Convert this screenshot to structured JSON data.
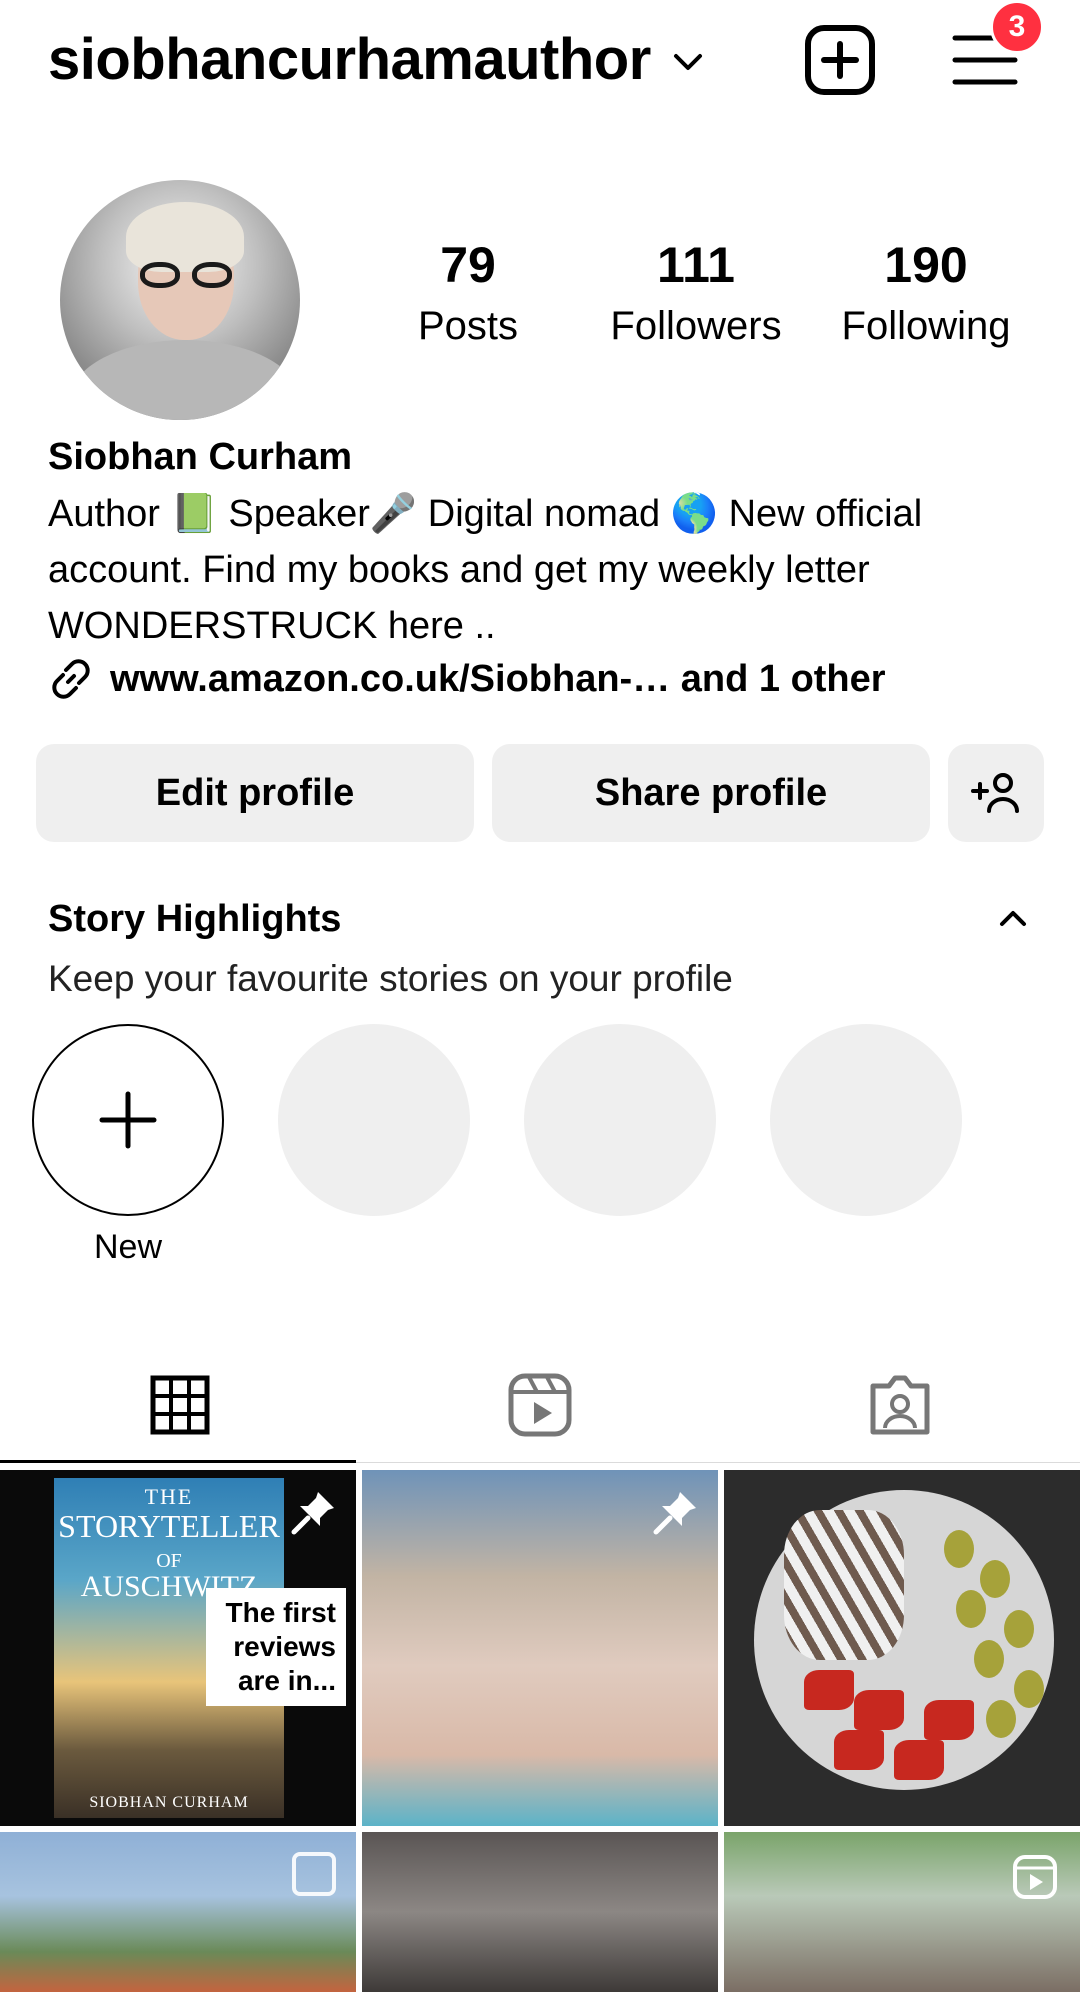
{
  "header": {
    "username": "siobhancurhamauthor",
    "notification_count": "3"
  },
  "profile": {
    "stats": [
      {
        "value": "79",
        "label": "Posts"
      },
      {
        "value": "111",
        "label": "Followers"
      },
      {
        "value": "190",
        "label": "Following"
      }
    ],
    "name": "Siobhan Curham",
    "bio_line1": "Author 📗 Speaker🎤 Digital nomad 🌎 New official",
    "bio_line2": "account. Find my books and get my weekly letter",
    "bio_line3": "WONDERSTRUCK here ..",
    "link": "www.amazon.co.uk/Siobhan-… and 1 other"
  },
  "buttons": {
    "edit": "Edit profile",
    "share": "Share profile"
  },
  "highlights": {
    "title": "Story Highlights",
    "subtitle": "Keep your favourite stories on your profile",
    "new_label": "New"
  },
  "tabs": [
    {
      "icon": "grid-icon"
    },
    {
      "icon": "reels-icon"
    },
    {
      "icon": "tagged-icon"
    }
  ],
  "posts": {
    "book": {
      "line1": "THE",
      "line2": "STORYTELLER",
      "line3": "OF",
      "line4": "AUSCHWITZ",
      "author": "SIOBHAN CURHAM",
      "note": "The first reviews are in..."
    }
  }
}
